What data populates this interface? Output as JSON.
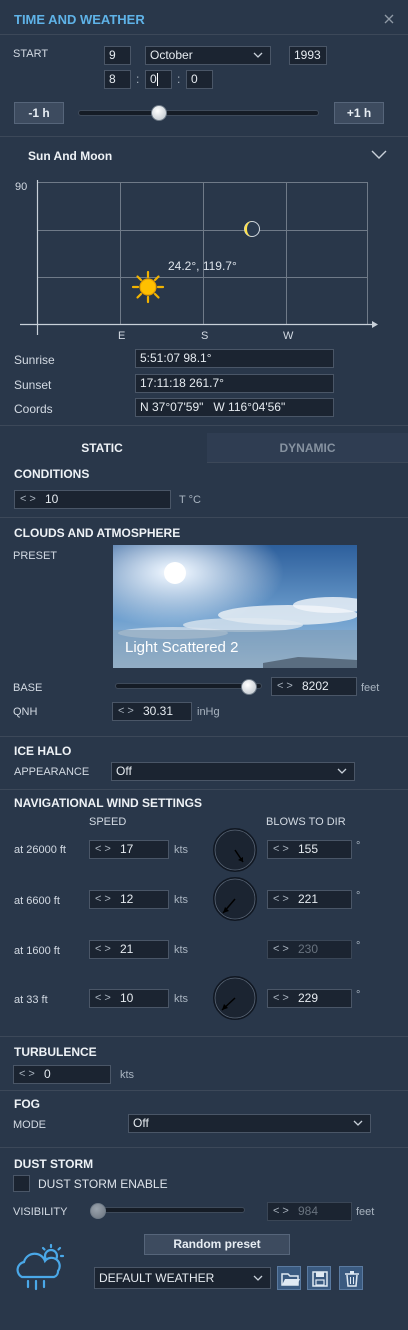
{
  "window": {
    "title": "TIME AND WEATHER",
    "close_icon": "close-icon"
  },
  "start": {
    "label": "START",
    "day": "9",
    "month": "October",
    "year": "1993",
    "hour": "8",
    "minute": "0",
    "second": "0",
    "minus_label": "-1 h",
    "plus_label": "+1 h"
  },
  "sun_moon": {
    "title": "Sun And Moon",
    "y_tick": "90",
    "x_ticks": [
      "E",
      "S",
      "W"
    ],
    "sun_label": "24.2°, 119.7°",
    "rows": [
      {
        "label": "Sunrise",
        "value": "5:51:07 98.1°"
      },
      {
        "label": "Sunset",
        "value": "17:11:18 261.7°"
      },
      {
        "label": "Coords",
        "value": "N 37°07'59\"   W 116°04'56\""
      }
    ]
  },
  "tabs": {
    "static": "STATIC",
    "dynamic": "DYNAMIC"
  },
  "conditions": {
    "title": "CONDITIONS",
    "temp": "10",
    "temp_unit": "T °C"
  },
  "clouds": {
    "title": "CLOUDS AND ATMOSPHERE",
    "preset_label": "PRESET",
    "preset_name": "Light Scattered 2",
    "base_label": "BASE",
    "base_value": "8202",
    "base_unit": "feet",
    "base_fraction": 0.96,
    "qnh_label": "QNH",
    "qnh_value": "30.31",
    "qnh_unit": "inHg"
  },
  "ice_halo": {
    "title": "ICE HALO",
    "appearance_label": "APPEARANCE",
    "appearance_value": "Off"
  },
  "wind": {
    "title": "NAVIGATIONAL WIND SETTINGS",
    "speed_header": "SPEED",
    "dir_header": "BLOWS TO DIR",
    "unit": "kts",
    "deg": "°",
    "rows": [
      {
        "label": "at 26000 ft",
        "speed": "17",
        "dir": "155",
        "dial": true,
        "disabled": false
      },
      {
        "label": "at 6600 ft",
        "speed": "12",
        "dir": "221",
        "dial": true,
        "disabled": false
      },
      {
        "label": "at 1600 ft",
        "speed": "21",
        "dir": "230",
        "dial": false,
        "disabled": true
      },
      {
        "label": "at 33 ft",
        "speed": "10",
        "dir": "229",
        "dial": true,
        "disabled": false
      }
    ]
  },
  "turbulence": {
    "title": "TURBULENCE",
    "value": "0",
    "unit": "kts"
  },
  "fog": {
    "title": "FOG",
    "mode_label": "MODE",
    "mode_value": "Off"
  },
  "dust": {
    "title": "DUST STORM",
    "enable_label": "DUST STORM ENABLE",
    "visibility_label": "VISIBILITY",
    "visibility_value": "984",
    "visibility_unit": "feet"
  },
  "bottom": {
    "random_label": "Random preset",
    "weather_select": "DEFAULT WEATHER"
  }
}
